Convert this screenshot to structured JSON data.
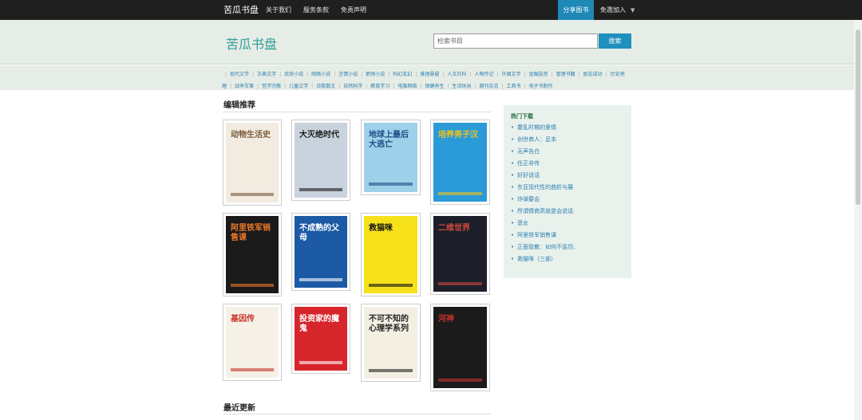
{
  "topbar": {
    "brand": "苦瓜书盘",
    "nav": [
      "关于我们",
      "服务条款",
      "免责声明"
    ],
    "share": "分享图书",
    "join": "免邀加入"
  },
  "header": {
    "logo": "苦瓜书盘",
    "search_placeholder": "检索书目",
    "search_button": "搜索"
  },
  "categories": [
    "现代文学",
    "古典文学",
    "武侠小说",
    "网络小说",
    "言情小说",
    "职场小说",
    "科幻玄幻",
    "推理悬疑",
    "人文社科",
    "人物传记",
    "外国文学",
    "金融投资",
    "管理书籍",
    "励志成功",
    "历史地理",
    "战争军事",
    "哲学宗教",
    "儿童文学",
    "诗歌散文",
    "自然科学",
    "教育学习",
    "电脑网络",
    "保健养生",
    "生活休闲",
    "期刊杂志",
    "工具书",
    "电子书制作"
  ],
  "editor_pick": {
    "title": "编辑推荐",
    "books": [
      {
        "name": "动物生活史",
        "bg": "#f1ebe0",
        "accent": "#7a5a3a"
      },
      {
        "name": "大灭绝时代",
        "bg": "#c9d3de",
        "accent": "#1a1a1a"
      },
      {
        "name": "地球上最后大逃亡",
        "bg": "#9fd0ea",
        "accent": "#1d4f86"
      },
      {
        "name": "培养男子汉",
        "bg": "#2b9bd8",
        "accent": "#f3c21a"
      },
      {
        "name": "阿里铁军销售课",
        "bg": "#1a1a1a",
        "accent": "#e7772a"
      },
      {
        "name": "不成熟的父母",
        "bg": "#1c5aa5",
        "accent": "#ffffff"
      },
      {
        "name": "救猫咪",
        "bg": "#f7e11b",
        "accent": "#111111"
      },
      {
        "name": "二维世界",
        "bg": "#1c1f2a",
        "accent": "#d04a3a"
      },
      {
        "name": "基因传",
        "bg": "#f6f1e7",
        "accent": "#c8332c"
      },
      {
        "name": "投资家的魔鬼",
        "bg": "#d6262b",
        "accent": "#ffffff"
      },
      {
        "name": "不可不知的心理学系列",
        "bg": "#f3efe3",
        "accent": "#222222"
      },
      {
        "name": "河神",
        "bg": "#1b1b1b",
        "accent": "#c8332c"
      }
    ]
  },
  "recent": {
    "title": "最近更新"
  },
  "hot": {
    "title": "热门下载",
    "items": [
      "霍乱时期的爱情",
      "创世商人：足本",
      "无声告白",
      "任正非传",
      "好好说话",
      "东亚现代性的曲折与展",
      "炸弹要会",
      "所谓情商高就是会说话",
      "恶女",
      "阿里铁军销售课",
      "正面管教：如何不惩罚、",
      "救猫咪（三部）"
    ]
  }
}
